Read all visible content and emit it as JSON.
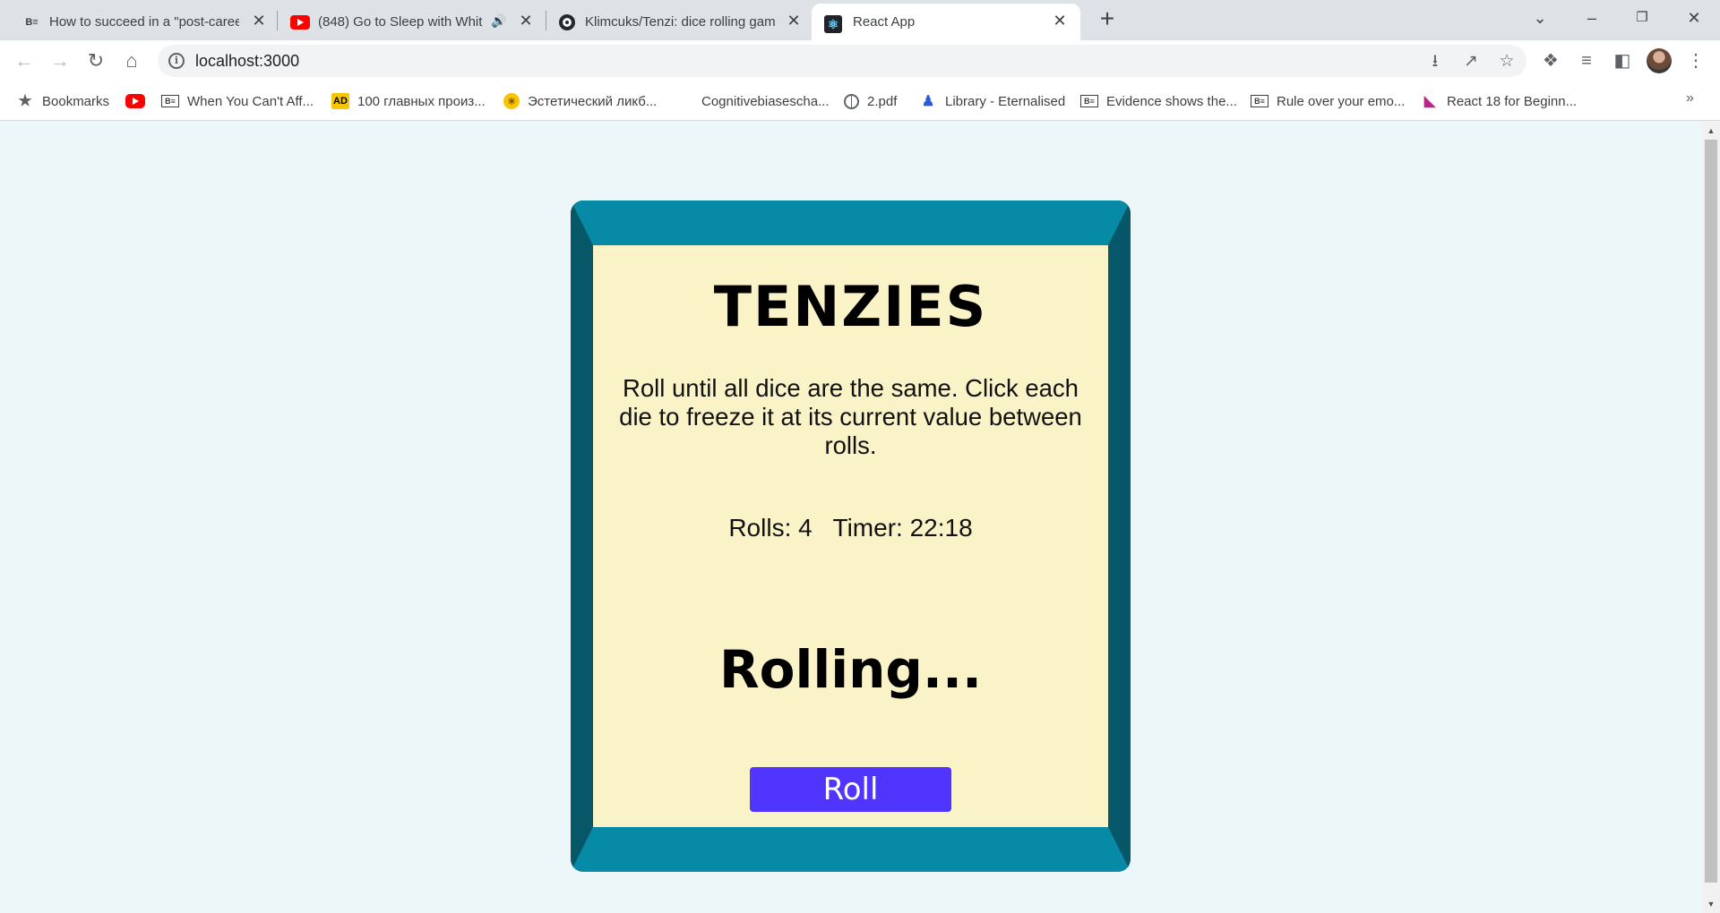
{
  "browser": {
    "tabs": [
      {
        "title": "How to succeed in a \"post-caree",
        "icon": "bi-favicon"
      },
      {
        "title": "(848) Go to Sleep with Whit",
        "icon": "youtube-favicon"
      },
      {
        "title": "Klimcuks/Tenzi: dice rolling gam",
        "icon": "github-favicon"
      },
      {
        "title": "React App",
        "icon": "react-favicon"
      }
    ],
    "url": "localhost:3000"
  },
  "bookmarks": [
    {
      "label": "Bookmarks",
      "icon": "star-icon"
    },
    {
      "label": "",
      "icon": "youtube-icon"
    },
    {
      "label": "When You Can't Aff...",
      "icon": "bi-icon"
    },
    {
      "label": "100 главных произ...",
      "icon": "ad-icon"
    },
    {
      "label": "Эстетический ликб...",
      "icon": "bulb-icon"
    },
    {
      "label": "Cognitivebiasescha...",
      "icon": ""
    },
    {
      "label": "2.pdf",
      "icon": "globe-icon"
    },
    {
      "label": "Library - Eternalised",
      "icon": "library-icon"
    },
    {
      "label": "Evidence shows the...",
      "icon": "bi-icon"
    },
    {
      "label": "Rule over your emo...",
      "icon": "bi-icon"
    },
    {
      "label": "React 18 for Beginn...",
      "icon": "m-icon"
    }
  ],
  "app": {
    "title": "TENZIES",
    "instructions": "Roll until all dice are the same. Click each die to freeze it at its current value between rolls.",
    "stats": "Rolls: 4   Timer: 22:18",
    "status": "Rolling...",
    "roll_label": "Roll"
  },
  "colors": {
    "page_background": "#edf7f9",
    "frame_outer": "#078aa6",
    "frame_inner": "#065868",
    "board": "#fbf3c8",
    "button": "#5035ff"
  }
}
